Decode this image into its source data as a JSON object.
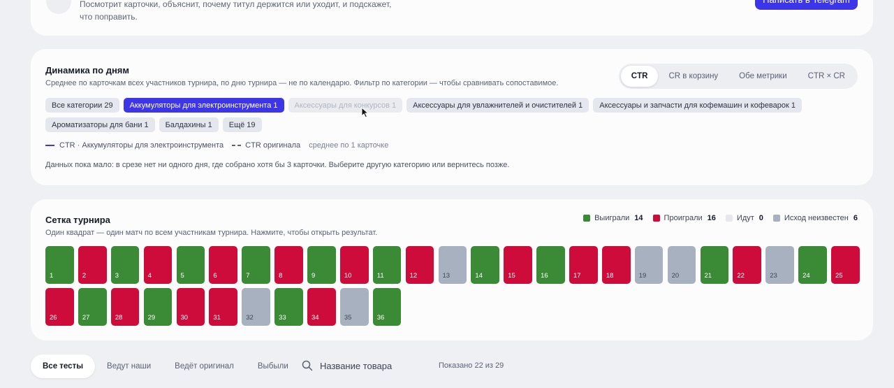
{
  "top_card": {
    "description_line1": "Посмотрит карточки, объяснит, почему титул держится или уходит, и подскажет,",
    "description_line2": "что поправить.",
    "button_label": "Написать в Telegram"
  },
  "dynamics": {
    "title": "Динамика по дням",
    "subtitle": "Среднее по карточкам всех участников турнира, по дню турнира — не по календарю. Фильтр по категории — чтобы сравнивать сопоставимое.",
    "metric_tabs": [
      {
        "label": "CTR",
        "active": true
      },
      {
        "label": "CR в корзину",
        "active": false
      },
      {
        "label": "Обе метрики",
        "active": false
      },
      {
        "label": "CTR × CR",
        "active": false
      }
    ],
    "category_chips": [
      {
        "label": "Все категории 29",
        "state": "normal"
      },
      {
        "label": "Аккумуляторы для электроинструмента 1",
        "state": "active"
      },
      {
        "label": "Аксессуары для конкурсов 1",
        "state": "disabled"
      },
      {
        "label": "Аксессуары для увлажнителей и очистителей 1",
        "state": "normal"
      },
      {
        "label": "Аксессуары и запчасти для кофемашин и кофеварок 1",
        "state": "normal"
      },
      {
        "label": "Ароматизаторы для бани 1",
        "state": "normal"
      },
      {
        "label": "Балдахины 1",
        "state": "normal"
      },
      {
        "label": "Ещё 19",
        "state": "normal"
      }
    ],
    "legend": {
      "series_ctr": "CTR · Аккумуляторы для электроинструмента",
      "series_original": "CTR оригинала",
      "note": "среднее по 1 карточке"
    },
    "empty_note": "Данных пока мало: в срезе нет ни одного дня, где собрано хотя бы 3 карточки. Выберите другую категорию или вернитесь позже.",
    "accent_color": "#3d35e8"
  },
  "grid": {
    "title": "Сетка турнира",
    "subtitle": "Один квадрат — один матч по всем участникам турнира. Нажмите, чтобы открыть результат.",
    "legend": [
      {
        "label": "Выиграли",
        "count": "14",
        "color": "#3a8a36"
      },
      {
        "label": "Проиграли",
        "count": "16",
        "color": "#cd0c3b"
      },
      {
        "label": "Идут",
        "count": "0",
        "color": "#e6e8ec"
      },
      {
        "label": "Исход неизвестен",
        "count": "6",
        "color": "#a8b1c0"
      }
    ],
    "matches": [
      {
        "n": "1",
        "status": "won"
      },
      {
        "n": "2",
        "status": "lost"
      },
      {
        "n": "3",
        "status": "won"
      },
      {
        "n": "4",
        "status": "lost"
      },
      {
        "n": "5",
        "status": "won"
      },
      {
        "n": "6",
        "status": "lost"
      },
      {
        "n": "7",
        "status": "won"
      },
      {
        "n": "8",
        "status": "lost"
      },
      {
        "n": "9",
        "status": "won"
      },
      {
        "n": "10",
        "status": "lost"
      },
      {
        "n": "11",
        "status": "won"
      },
      {
        "n": "12",
        "status": "lost"
      },
      {
        "n": "13",
        "status": "unknown"
      },
      {
        "n": "14",
        "status": "won"
      },
      {
        "n": "15",
        "status": "lost"
      },
      {
        "n": "16",
        "status": "won"
      },
      {
        "n": "17",
        "status": "lost"
      },
      {
        "n": "18",
        "status": "lost"
      },
      {
        "n": "19",
        "status": "unknown"
      },
      {
        "n": "20",
        "status": "unknown"
      },
      {
        "n": "21",
        "status": "won"
      },
      {
        "n": "22",
        "status": "lost"
      },
      {
        "n": "23",
        "status": "unknown"
      },
      {
        "n": "24",
        "status": "won"
      },
      {
        "n": "25",
        "status": "lost"
      },
      {
        "n": "26",
        "status": "lost"
      },
      {
        "n": "27",
        "status": "won"
      },
      {
        "n": "28",
        "status": "lost"
      },
      {
        "n": "29",
        "status": "won"
      },
      {
        "n": "30",
        "status": "lost"
      },
      {
        "n": "31",
        "status": "lost"
      },
      {
        "n": "32",
        "status": "unknown"
      },
      {
        "n": "33",
        "status": "won"
      },
      {
        "n": "34",
        "status": "lost"
      },
      {
        "n": "35",
        "status": "unknown"
      },
      {
        "n": "36",
        "status": "won"
      }
    ]
  },
  "filters": {
    "tabs": [
      {
        "label": "Все тесты",
        "active": true
      },
      {
        "label": "Ведут наши",
        "active": false
      },
      {
        "label": "Ведёт оригинал",
        "active": false
      },
      {
        "label": "Выбыли",
        "active": false
      }
    ],
    "search_placeholder": "Название товара",
    "shown_text": "Показано 22 из 29"
  }
}
